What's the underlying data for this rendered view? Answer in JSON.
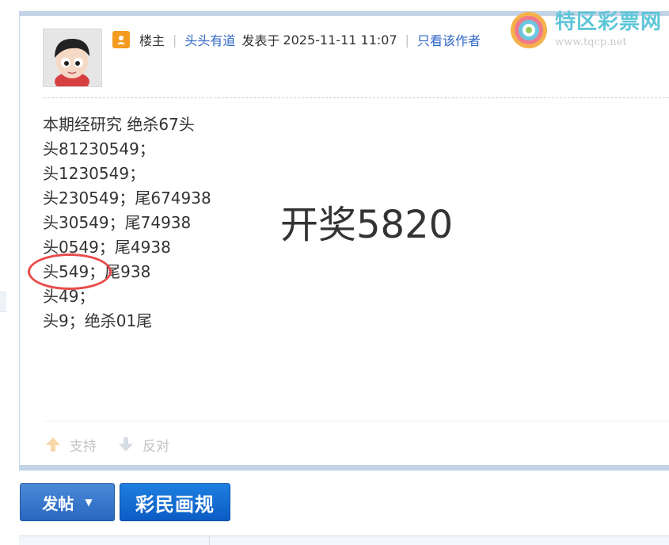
{
  "post": {
    "owner_label": "楼主",
    "author": "头头有道",
    "posted_prefix": "发表于",
    "datetime": "2025-11-11 11:07",
    "only_author_link": "只看该作者"
  },
  "logo": {
    "name": "特区彩票网",
    "url": "www.tqcp.net"
  },
  "content": {
    "lines": [
      "本期经研究 绝杀67头",
      "头81230549；",
      "头1230549；",
      "头230549；尾674938",
      "头30549；尾74938",
      "头0549；尾4938",
      "头549；尾938",
      "头49；",
      "头9；绝杀01尾"
    ],
    "overlay": "开奖5820"
  },
  "votes": {
    "support": "支持",
    "oppose": "反对"
  },
  "buttons": {
    "post": "发帖",
    "rules": "彩民画规"
  },
  "colors": {
    "frame_bar": "#c2d3e6",
    "link": "#2f66c6",
    "highlight_circle": "#e84a4a",
    "button_blue": "#2a67bf"
  }
}
